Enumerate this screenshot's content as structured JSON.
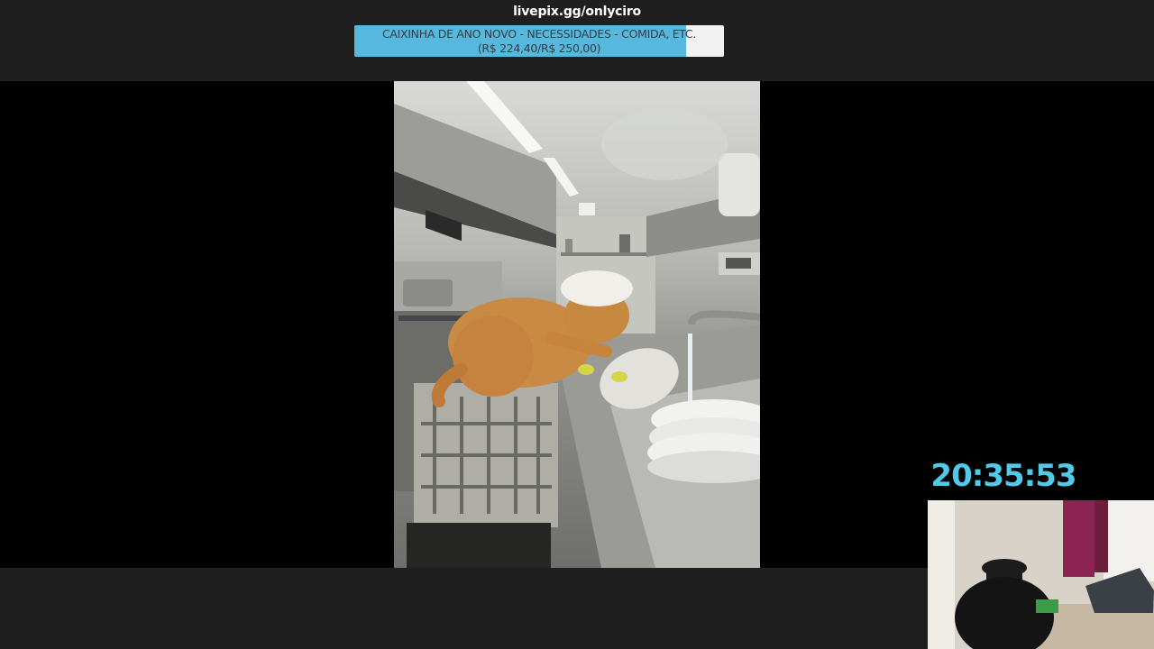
{
  "overlay": {
    "donation_link": "livepix.gg/onlyciro",
    "goal": {
      "line1": "CAIXINHA DE ANO NOVO - NECESSIDADES - COMIDA, ETC.",
      "line2": "(R$ 224,40/R$ 250,00)",
      "current": 224.4,
      "target": 250.0,
      "fill_color": "#55b8dc"
    },
    "clock": "20:35:53",
    "clock_color": "#52c9e8"
  },
  "video": {
    "subject": "cat-washing-dishes-in-kitchen"
  },
  "webcam": {
    "subject": "room-with-office-chair"
  }
}
